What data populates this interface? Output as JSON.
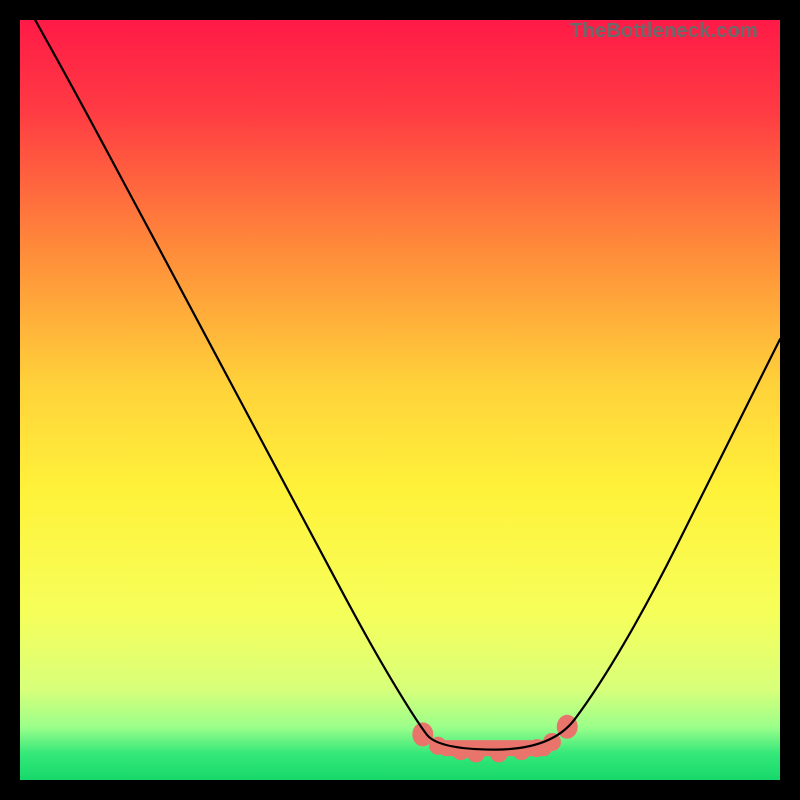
{
  "watermark": "TheBottleneck.com",
  "chart_data": {
    "type": "line",
    "title": "",
    "xlabel": "",
    "ylabel": "",
    "xlim": [
      0,
      100
    ],
    "ylim": [
      0,
      100
    ],
    "grid": false,
    "legend": false,
    "series": [
      {
        "name": "left-curve",
        "description": "Steep descending curve from upper-left into the trough",
        "points": [
          {
            "x": 2,
            "y": 100
          },
          {
            "x": 7,
            "y": 91
          },
          {
            "x": 14,
            "y": 78
          },
          {
            "x": 22,
            "y": 63
          },
          {
            "x": 30,
            "y": 48
          },
          {
            "x": 38,
            "y": 33
          },
          {
            "x": 46,
            "y": 18
          },
          {
            "x": 52,
            "y": 8
          },
          {
            "x": 55,
            "y": 4
          }
        ]
      },
      {
        "name": "trough",
        "description": "Flat minimum segment",
        "points": [
          {
            "x": 55,
            "y": 4
          },
          {
            "x": 70,
            "y": 4
          }
        ]
      },
      {
        "name": "right-curve",
        "description": "Rising curve from trough toward upper-right",
        "points": [
          {
            "x": 70,
            "y": 4
          },
          {
            "x": 76,
            "y": 12
          },
          {
            "x": 83,
            "y": 24
          },
          {
            "x": 90,
            "y": 38
          },
          {
            "x": 96,
            "y": 50
          },
          {
            "x": 100,
            "y": 58
          }
        ]
      },
      {
        "name": "highlight-dots",
        "description": "Salmon-colored blob markers emphasizing the trough region",
        "type": "scatter",
        "points": [
          {
            "x": 53,
            "y": 6
          },
          {
            "x": 55,
            "y": 4.5
          },
          {
            "x": 58,
            "y": 3.8
          },
          {
            "x": 60,
            "y": 3.5
          },
          {
            "x": 63,
            "y": 3.5
          },
          {
            "x": 66,
            "y": 3.8
          },
          {
            "x": 68,
            "y": 4.2
          },
          {
            "x": 70,
            "y": 5
          },
          {
            "x": 72,
            "y": 7
          }
        ]
      }
    ],
    "gradient_bands": {
      "description": "Background vertical gradient bands, red→yellow→green from top to bottom",
      "stops": [
        {
          "offset": 0.0,
          "color": "#ff1a47"
        },
        {
          "offset": 0.12,
          "color": "#ff3b43"
        },
        {
          "offset": 0.3,
          "color": "#ff8a3a"
        },
        {
          "offset": 0.48,
          "color": "#ffd23a"
        },
        {
          "offset": 0.62,
          "color": "#fff23a"
        },
        {
          "offset": 0.78,
          "color": "#f6ff5a"
        },
        {
          "offset": 0.88,
          "color": "#d8ff7a"
        },
        {
          "offset": 0.93,
          "color": "#9cff8a"
        },
        {
          "offset": 0.965,
          "color": "#35e87a"
        },
        {
          "offset": 1.0,
          "color": "#17d86a"
        }
      ]
    }
  }
}
